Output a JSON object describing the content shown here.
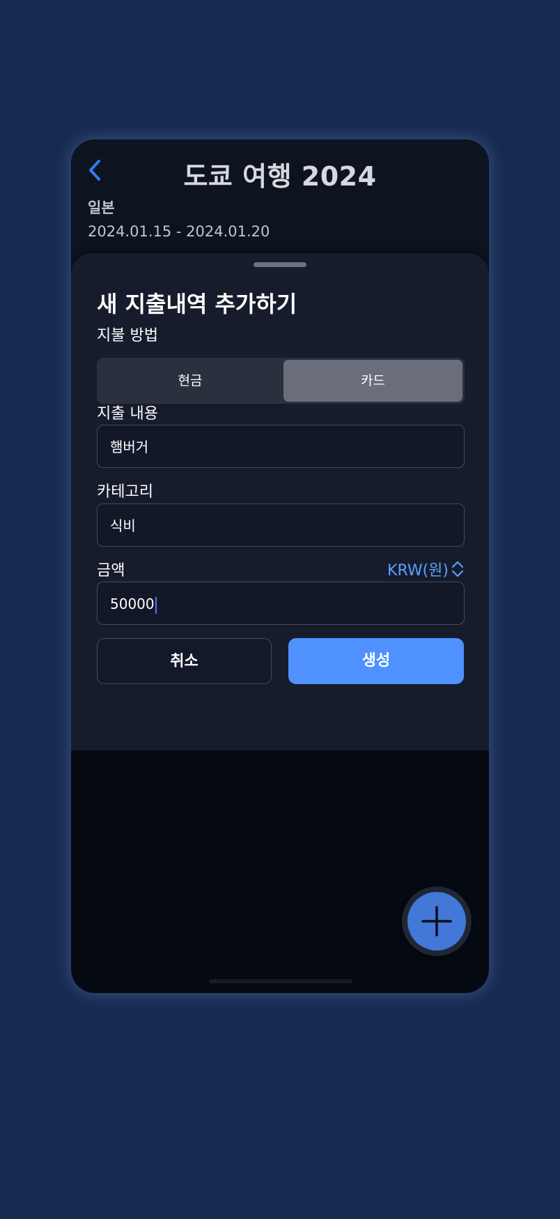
{
  "trip": {
    "title": "도쿄 여행 2024",
    "country": "일본",
    "dates": "2024.01.15 - 2024.01.20"
  },
  "sheet": {
    "title": "새 지출내역 추가하기",
    "payment": {
      "label": "지불 방법",
      "options": [
        "현금",
        "카드"
      ],
      "selected": "카드"
    },
    "description": {
      "label": "지출 내용",
      "value": "햄버거"
    },
    "category": {
      "label": "카테고리",
      "value": "식비"
    },
    "amount": {
      "label": "금액",
      "value": "50000",
      "currency": "KRW(원)"
    },
    "actions": {
      "cancel": "취소",
      "create": "생성"
    }
  },
  "colors": {
    "accent": "#4f91ff",
    "currency_link": "#5aa0ff",
    "fab": "#4377d8",
    "background": "#172b52"
  },
  "icons": {
    "back": "chevron-left-icon",
    "currency_toggle": "chevron-up-down-icon",
    "fab": "plus-icon"
  }
}
